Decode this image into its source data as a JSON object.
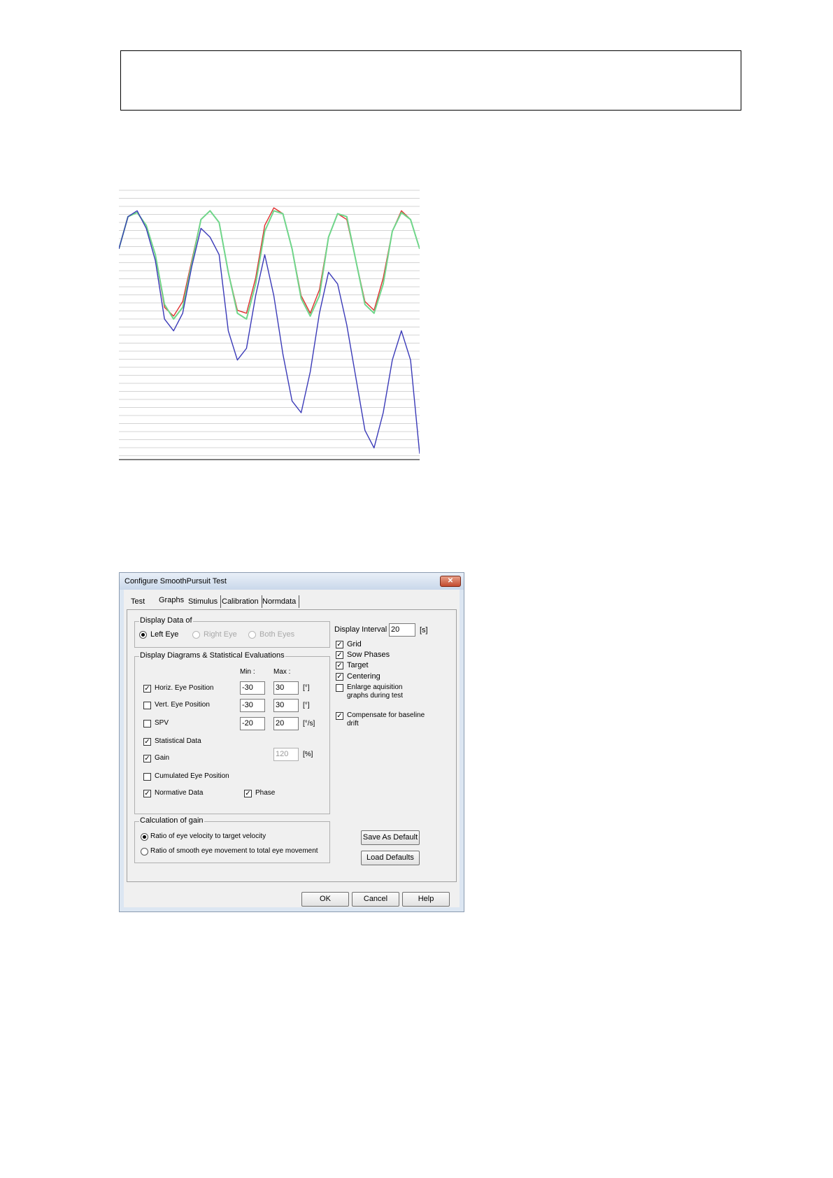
{
  "header_box": {},
  "chart_data": {
    "type": "line",
    "title": "",
    "xlabel": "",
    "ylabel": "",
    "grid": true,
    "series": [
      {
        "color": "#e03030",
        "values": [
          0.3,
          0.85,
          0.92,
          0.7,
          0.2,
          -0.7,
          -0.85,
          -0.6,
          0.1,
          0.8,
          0.95,
          0.75,
          -0.1,
          -0.75,
          -0.8,
          -0.2,
          0.7,
          1.0,
          0.9,
          0.3,
          -0.5,
          -0.8,
          -0.4,
          0.5,
          0.9,
          0.8,
          0.1,
          -0.6,
          -0.75,
          -0.2,
          0.6,
          0.95,
          0.8,
          0.3
        ]
      },
      {
        "color": "#6fd68a",
        "values": [
          0.3,
          0.85,
          0.92,
          0.7,
          0.2,
          -0.65,
          -0.9,
          -0.7,
          0.05,
          0.8,
          0.95,
          0.75,
          -0.1,
          -0.8,
          -0.9,
          -0.3,
          0.6,
          0.95,
          0.9,
          0.3,
          -0.55,
          -0.85,
          -0.5,
          0.5,
          0.9,
          0.85,
          0.1,
          -0.65,
          -0.8,
          -0.3,
          0.6,
          0.92,
          0.8,
          0.3
        ]
      },
      {
        "color": "#3a3ab8",
        "values": [
          0.3,
          0.85,
          0.95,
          0.65,
          0.1,
          -0.9,
          -1.1,
          -0.8,
          0.0,
          0.65,
          0.5,
          0.2,
          -1.1,
          -1.6,
          -1.4,
          -0.5,
          0.2,
          -0.5,
          -1.5,
          -2.3,
          -2.5,
          -1.8,
          -0.8,
          -0.1,
          -0.3,
          -1.0,
          -1.9,
          -2.8,
          -3.1,
          -2.5,
          -1.6,
          -1.1,
          -1.6,
          -3.2
        ]
      }
    ]
  },
  "dialog": {
    "title": "Configure SmoothPursuit Test",
    "close_glyph": "✕",
    "tabs": [
      "Test",
      "Graphs",
      "Stimulus",
      "Calibration",
      "Normdata"
    ],
    "display_data_of": {
      "label": "Display Data of",
      "left_eye": "Left Eye",
      "right_eye": "Right Eye",
      "both_eyes": "Both Eyes"
    },
    "display_interval": {
      "label": "Display Interval :",
      "value": "20",
      "unit": "[s]"
    },
    "diagrams": {
      "label": "Display Diagrams & Statistical Evaluations",
      "min_label": "Min :",
      "max_label": "Max :",
      "horiz": {
        "label": "Horiz. Eye Position",
        "checked": true,
        "min": "-30",
        "max": "30",
        "unit": "[°]"
      },
      "vert": {
        "label": "Vert. Eye Position",
        "checked": false,
        "min": "-30",
        "max": "30",
        "unit": "[°]"
      },
      "spv": {
        "label": "SPV",
        "checked": false,
        "min": "-20",
        "max": "20",
        "unit": "[°/s]"
      },
      "statistical": {
        "label": "Statistical Data",
        "checked": true
      },
      "gain": {
        "label": "Gain",
        "checked": true,
        "max": "120",
        "unit": "[%]"
      },
      "cumulated": {
        "label": "Cumulated Eye Position",
        "checked": false
      },
      "normative": {
        "label": "Normative Data",
        "checked": true
      },
      "phase": {
        "label": "Phase",
        "checked": true
      }
    },
    "options": {
      "grid": "Grid",
      "slow_phases": "Sow Phases",
      "target": "Target",
      "centering": "Centering",
      "enlarge_1": "Enlarge aquisition",
      "enlarge_2": "graphs during test",
      "compensate_1": "Compensate for baseline",
      "compensate_2": "drift"
    },
    "gain_calc": {
      "label": "Calculation of gain",
      "option1": "Ratio of eye velocity to target velocity",
      "option2": "Ratio of smooth eye movement to total eye movement"
    },
    "buttons": {
      "save_default": "Save As Default",
      "load_defaults": "Load Defaults",
      "ok": "OK",
      "cancel": "Cancel",
      "help": "Help"
    },
    "check_glyph": "✓"
  }
}
